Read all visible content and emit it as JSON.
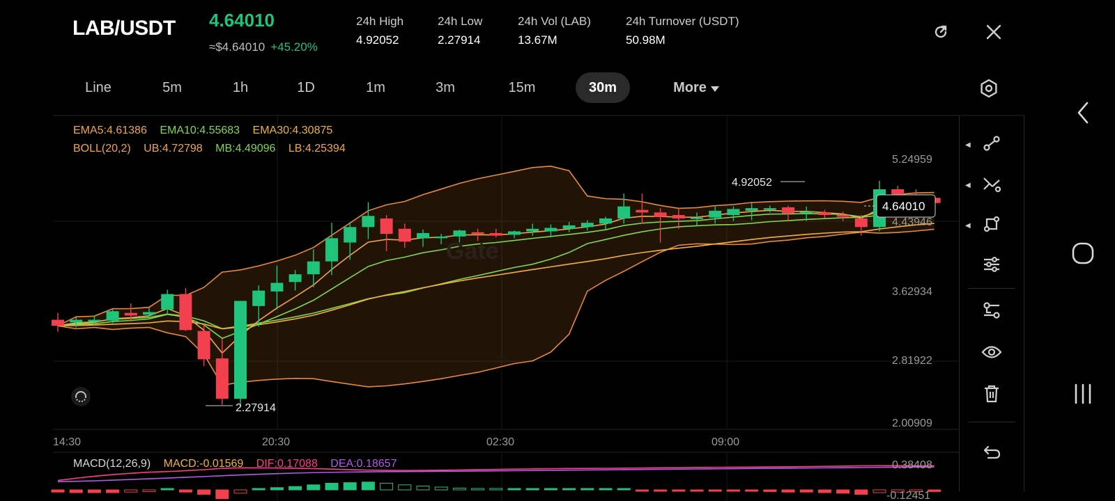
{
  "header": {
    "pair": "LAB/USDT",
    "last_price": "4.64010",
    "approx_price": "≈$4.64010",
    "change": "+45.20%",
    "stats": [
      {
        "label": "24h   High",
        "value": "4.92052"
      },
      {
        "label": "24h   Low",
        "value": "2.27914"
      },
      {
        "label": "24h   Vol (LAB)",
        "value": "13.67M"
      },
      {
        "label": "24h   Turnover (USDT)",
        "value": "50.98M"
      }
    ],
    "icons": [
      "refresh-icon",
      "close-icon"
    ]
  },
  "timeframes": {
    "items": [
      "Line",
      "5m",
      "1h",
      "1D",
      "1m",
      "3m",
      "15m",
      "30m",
      "More"
    ],
    "active": "30m",
    "more_icon": "caret-down-icon",
    "settings_icon": "settings-icon"
  },
  "legend": {
    "ema5": "EMA5:4.61386",
    "ema10": "EMA10:4.55683",
    "ema30": "EMA30:4.30875",
    "boll": "BOLL(20,2)",
    "ub": "UB:4.72798",
    "mb": "MB:4.49096",
    "lb": "LB:4.25394"
  },
  "macd_legend": {
    "title": "MACD(12,26,9)",
    "macd": "MACD:-0.01569",
    "dif": "DIF:0.17088",
    "dea": "DEA:0.18657"
  },
  "colors": {
    "up": "#20c37c",
    "down": "#f2404f",
    "ema5": "#f0a64e",
    "ema10": "#7fd84e",
    "ema30": "#f2b23a",
    "boll": "#e88a3a",
    "dif": "#ff3d8b",
    "dea": "#b15ce6"
  },
  "chart_data": {
    "type": "candlestick",
    "y_axis_labels": [
      "5.24959",
      "4.43946",
      "3.62934",
      "2.81922",
      "2.00909"
    ],
    "x_axis_labels": [
      "14:30",
      "20:30",
      "02:30",
      "09:00"
    ],
    "current_price_label": "4.64010",
    "high_marker": "4.92052",
    "low_marker": "2.27914",
    "macd_axis_labels": [
      "0.38408",
      "-0.12451"
    ],
    "candles": [
      {
        "o": 3.3,
        "h": 3.38,
        "l": 3.16,
        "c": 3.23
      },
      {
        "o": 3.27,
        "h": 3.33,
        "l": 3.21,
        "c": 3.3
      },
      {
        "o": 3.28,
        "h": 3.35,
        "l": 3.24,
        "c": 3.3
      },
      {
        "o": 3.29,
        "h": 3.42,
        "l": 3.26,
        "c": 3.4
      },
      {
        "o": 3.38,
        "h": 3.49,
        "l": 3.28,
        "c": 3.35
      },
      {
        "o": 3.36,
        "h": 3.44,
        "l": 3.31,
        "c": 3.39
      },
      {
        "o": 3.42,
        "h": 3.65,
        "l": 3.36,
        "c": 3.6
      },
      {
        "o": 3.6,
        "h": 3.67,
        "l": 3.17,
        "c": 3.18
      },
      {
        "o": 3.17,
        "h": 3.25,
        "l": 2.76,
        "c": 2.84
      },
      {
        "o": 2.85,
        "h": 3.08,
        "l": 2.31,
        "c": 2.38
      },
      {
        "o": 2.38,
        "h": 3.52,
        "l": 2.28,
        "c": 3.52
      },
      {
        "o": 3.46,
        "h": 3.7,
        "l": 3.22,
        "c": 3.64
      },
      {
        "o": 3.63,
        "h": 3.93,
        "l": 3.42,
        "c": 3.73
      },
      {
        "o": 3.74,
        "h": 3.88,
        "l": 3.64,
        "c": 3.83
      },
      {
        "o": 3.83,
        "h": 4.12,
        "l": 3.68,
        "c": 3.98
      },
      {
        "o": 3.98,
        "h": 4.43,
        "l": 3.82,
        "c": 4.25
      },
      {
        "o": 4.2,
        "h": 4.44,
        "l": 4.0,
        "c": 4.38
      },
      {
        "o": 4.38,
        "h": 4.67,
        "l": 4.24,
        "c": 4.51
      },
      {
        "o": 4.48,
        "h": 4.52,
        "l": 4.1,
        "c": 4.3
      },
      {
        "o": 4.36,
        "h": 4.42,
        "l": 4.14,
        "c": 4.21
      },
      {
        "o": 4.25,
        "h": 4.35,
        "l": 4.15,
        "c": 4.31
      },
      {
        "o": 4.25,
        "h": 4.3,
        "l": 4.18,
        "c": 4.27
      },
      {
        "o": 4.27,
        "h": 4.35,
        "l": 4.2,
        "c": 4.34
      },
      {
        "o": 4.32,
        "h": 4.36,
        "l": 4.22,
        "c": 4.3
      },
      {
        "o": 4.31,
        "h": 4.36,
        "l": 4.26,
        "c": 4.28
      },
      {
        "o": 4.29,
        "h": 4.34,
        "l": 4.25,
        "c": 4.33
      },
      {
        "o": 4.33,
        "h": 4.42,
        "l": 4.28,
        "c": 4.36
      },
      {
        "o": 4.33,
        "h": 4.41,
        "l": 4.26,
        "c": 4.37
      },
      {
        "o": 4.36,
        "h": 4.44,
        "l": 4.32,
        "c": 4.4
      },
      {
        "o": 4.38,
        "h": 4.46,
        "l": 4.34,
        "c": 4.43
      },
      {
        "o": 4.42,
        "h": 4.5,
        "l": 4.35,
        "c": 4.48
      },
      {
        "o": 4.48,
        "h": 4.77,
        "l": 4.42,
        "c": 4.62
      },
      {
        "o": 4.58,
        "h": 4.77,
        "l": 4.42,
        "c": 4.55
      },
      {
        "o": 4.55,
        "h": 4.6,
        "l": 4.2,
        "c": 4.5
      },
      {
        "o": 4.52,
        "h": 4.6,
        "l": 4.36,
        "c": 4.48
      },
      {
        "o": 4.48,
        "h": 4.55,
        "l": 4.4,
        "c": 4.49
      },
      {
        "o": 4.49,
        "h": 4.62,
        "l": 4.42,
        "c": 4.57
      },
      {
        "o": 4.52,
        "h": 4.62,
        "l": 4.45,
        "c": 4.59
      },
      {
        "o": 4.57,
        "h": 4.66,
        "l": 4.46,
        "c": 4.6
      },
      {
        "o": 4.58,
        "h": 4.63,
        "l": 4.55,
        "c": 4.6
      },
      {
        "o": 4.61,
        "h": 4.63,
        "l": 4.45,
        "c": 4.54
      },
      {
        "o": 4.55,
        "h": 4.62,
        "l": 4.45,
        "c": 4.56
      },
      {
        "o": 4.55,
        "h": 4.58,
        "l": 4.48,
        "c": 4.52
      },
      {
        "o": 4.52,
        "h": 4.56,
        "l": 4.45,
        "c": 4.5
      },
      {
        "o": 4.48,
        "h": 4.52,
        "l": 4.28,
        "c": 4.38
      },
      {
        "o": 4.38,
        "h": 4.92,
        "l": 4.33,
        "c": 4.82
      },
      {
        "o": 4.82,
        "h": 4.86,
        "l": 4.68,
        "c": 4.76
      },
      {
        "o": 4.76,
        "h": 4.82,
        "l": 4.7,
        "c": 4.73
      },
      {
        "o": 4.72,
        "h": 4.74,
        "l": 4.64,
        "c": 4.66
      }
    ],
    "macd_hist": [
      -0.02,
      -0.025,
      -0.025,
      -0.025,
      -0.02,
      -0.015,
      0.01,
      -0.02,
      -0.04,
      -0.08,
      -0.03,
      0.01,
      0.02,
      0.03,
      0.045,
      0.06,
      0.065,
      0.07,
      0.06,
      0.045,
      0.035,
      0.025,
      0.015,
      0.01,
      0.005,
      0.005,
      0.005,
      0.005,
      0.005,
      0.005,
      0.005,
      0.005,
      -0.005,
      -0.005,
      -0.005,
      -0.01,
      -0.01,
      -0.01,
      -0.01,
      -0.015,
      -0.02,
      -0.02,
      -0.025,
      -0.03,
      -0.04,
      -0.025,
      -0.02,
      -0.015,
      -0.015
    ]
  },
  "toolbar": {
    "icons": [
      "trendline-icon",
      "crosshair-lines-icon",
      "shape-icon",
      "adjust-icon",
      "indicator-icon",
      "eye-icon",
      "trash-icon",
      "undo-icon"
    ],
    "watermark": "Gate"
  },
  "system_nav": {
    "icons": [
      "back-icon",
      "home-icon",
      "recents-icon"
    ]
  }
}
